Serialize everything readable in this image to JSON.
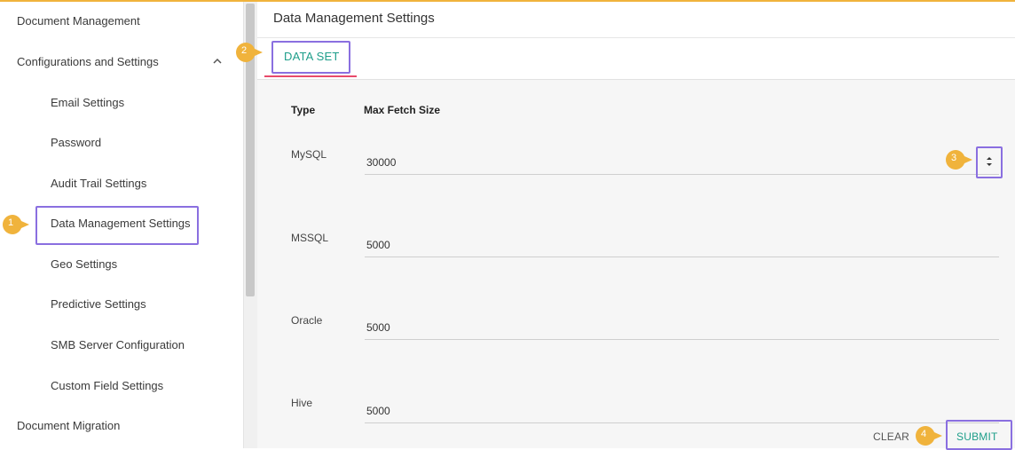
{
  "sidebar": {
    "items": [
      {
        "label": "Document Management"
      },
      {
        "label": "Configurations and Settings"
      },
      {
        "label": "Email Settings"
      },
      {
        "label": "Password"
      },
      {
        "label": "Audit Trail Settings"
      },
      {
        "label": "Data Management Settings"
      },
      {
        "label": "Geo Settings"
      },
      {
        "label": "Predictive Settings"
      },
      {
        "label": "SMB Server Configuration"
      },
      {
        "label": "Custom Field Settings"
      },
      {
        "label": "Document Migration"
      }
    ],
    "expand_icon": "chevron-up-icon"
  },
  "header": {
    "title": "Data Management Settings"
  },
  "tabs": [
    {
      "label": "DATA SET"
    }
  ],
  "table": {
    "columns": [
      "Type",
      "Max Fetch Size"
    ],
    "rows": [
      {
        "type": "MySQL",
        "value": "30000"
      },
      {
        "type": "MSSQL",
        "value": "5000"
      },
      {
        "type": "Oracle",
        "value": "5000"
      },
      {
        "type": "Hive",
        "value": "5000"
      }
    ]
  },
  "actions": {
    "clear_label": "CLEAR",
    "submit_label": "SUBMIT"
  },
  "markers": [
    "1",
    "2",
    "3",
    "4"
  ],
  "colors": {
    "accent": "#1e9e8a",
    "tab_underline": "#e84a6b",
    "highlight": "#8a6fe0",
    "marker": "#f0b33c"
  }
}
